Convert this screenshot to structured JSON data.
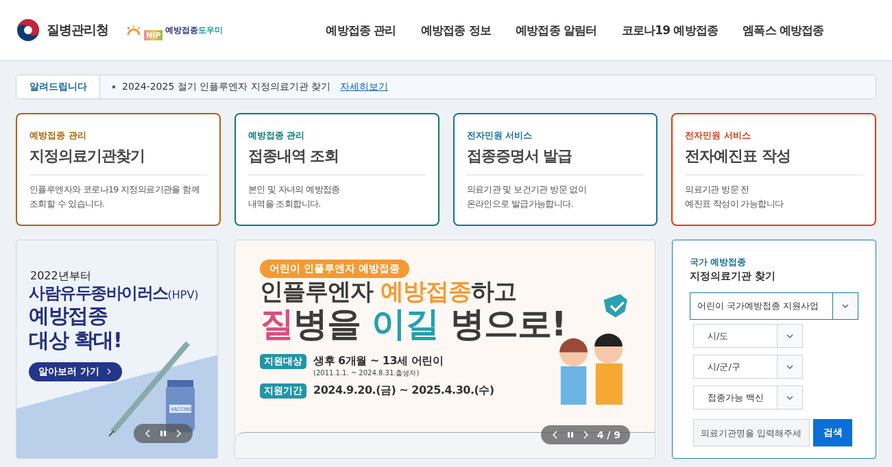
{
  "header": {
    "agency_name": "질병관리청",
    "helper_logo": {
      "badge": "NIP",
      "name_main": "예방접종",
      "name_accent": "도우미"
    },
    "nav": [
      {
        "label": "예방접종 관리"
      },
      {
        "label": "예방접종 정보"
      },
      {
        "label": "예방접종 알림터"
      },
      {
        "label": "코로나19 예방접종"
      },
      {
        "label": "엠폭스 예방접종"
      }
    ]
  },
  "notice": {
    "label": "알려드립니다",
    "text": "2024-2025 절기 인플루엔자 지정의료기관 찾기",
    "link": "자세히보기"
  },
  "cards": [
    {
      "category": "예방접종 관리",
      "title": "지정의료기관찾기",
      "description": [
        "인플루엔자와 코로나19 지정의료기관을 함께",
        "조회할 수 있습니다."
      ],
      "color": "#b0630c"
    },
    {
      "category": "예방접종 관리",
      "title": "접종내역 조회",
      "description": [
        "본인 및 자녀의 예방접종",
        "내역을 조회합니다."
      ],
      "color": "#0b7d6e"
    },
    {
      "category": "전자민원 서비스",
      "title": "접종증명서 발급",
      "description": [
        "의료기관 및 보건기관 방문 없이",
        "온라인으로 발급가능합니다."
      ],
      "color": "#1470a8"
    },
    {
      "category": "전자민원 서비스",
      "title": "전자예진표 작성",
      "description": [
        "의료기관 방문 전",
        "예진표 작성이 가능합니다"
      ],
      "color": "#d9400f"
    }
  ],
  "banner_left": {
    "year": "2022년부터",
    "line_1": "사람유두종바이러스",
    "line_1_suffix": "(HPV)",
    "line_2": "예방접종",
    "line_3": "대상 확대!",
    "button": "알아보러 가기",
    "vial_label": "VACCINE"
  },
  "banner_center": {
    "tag": "어린이 인플루엔자 예방접종",
    "headline": [
      [
        {
          "text": "인플루엔자 ",
          "kind": "plain"
        },
        {
          "text": "예방접종",
          "kind": "orange"
        },
        {
          "text": "하고",
          "kind": "plain"
        }
      ],
      [
        {
          "text": "질",
          "kind": "pink"
        },
        {
          "text": "병을 ",
          "kind": "plain"
        },
        {
          "text": "이길",
          "kind": "teal"
        },
        {
          "text": " 병으로!",
          "kind": "plain"
        }
      ]
    ],
    "rows": [
      {
        "label": "지원대상",
        "value": "생후 6개월 ~ 13세 어린이",
        "note": "(2011.1.1. ~ 2024.8.31.출생자)"
      },
      {
        "label": "지원기간",
        "value": "2024.9.20.(금) ~ 2025.4.30.(수)"
      }
    ],
    "counter": "4 / 9"
  },
  "finder": {
    "subtitle": "국가 예방접종",
    "title": "지정의료기관 찾기",
    "program_select": "어린이 국가예방접종 지원사업",
    "selects": [
      {
        "label": "시/도"
      },
      {
        "label": "시/군/구"
      },
      {
        "label": "접종가능 백신"
      }
    ],
    "search": {
      "placeholder": "의료기관명을 입력해주세"
    },
    "button": "검색"
  }
}
